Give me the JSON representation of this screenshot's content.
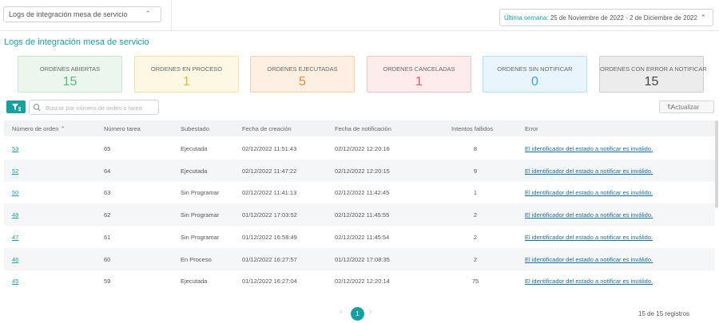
{
  "header": {
    "module_select": "Logs de integración mesa de servicio",
    "week_label": "Última semana:",
    "week_range": "25 de Noviembre de 2022 - 2 de Diciembre de 2022"
  },
  "page_title": "Logs de integración mesa de servicio",
  "cards": [
    {
      "label": "ORDENES ABIERTAS",
      "value": "15",
      "bg": "#eaf6ee",
      "border": "#c8e6d1",
      "value_color": "#5cb87a"
    },
    {
      "label": "ORDENES EN PROCESO",
      "value": "1",
      "bg": "#fdf8e4",
      "border": "#f2e3a8",
      "value_color": "#e5b53b"
    },
    {
      "label": "ORDENES EJECUTADAS",
      "value": "5",
      "bg": "#fdf0e3",
      "border": "#f2d2b0",
      "value_color": "#e98a35"
    },
    {
      "label": "ORDENES CANCELADAS",
      "value": "1",
      "bg": "#fdeceb",
      "border": "#f2c4c1",
      "value_color": "#e55b57"
    },
    {
      "label": "ORDENES SIN NOTIFICAR",
      "value": "0",
      "bg": "#e8f5fc",
      "border": "#b9e0f2",
      "value_color": "#3aa5d9"
    },
    {
      "label": "ORDENES CON ERROR A NOTIFICAR",
      "value": "15",
      "bg": "#ececec",
      "border": "#cfcfcf",
      "value_color": "#444444"
    }
  ],
  "toolbar": {
    "filter_icon": "filter-icon",
    "search_placeholder": "Buscar por número de orden o tarea",
    "refresh_label": "Actualizar"
  },
  "table": {
    "columns": [
      "Número de orden",
      "Número tarea",
      "Subestado",
      "Fecha de creación",
      "Fecha de notificación",
      "Intentos fallidos",
      "Error"
    ],
    "rows": [
      {
        "orden": "53",
        "tarea": "65",
        "subestado": "Ejecutada",
        "creacion": "02/12/2022 11:51:43",
        "notificacion": "02/12/2022 12:20:16",
        "intentos": "8",
        "error": "El identificador del estado a notificar es inválido."
      },
      {
        "orden": "52",
        "tarea": "64",
        "subestado": "Ejecutada",
        "creacion": "02/12/2022 11:47:22",
        "notificacion": "02/12/2022 12:20:15",
        "intentos": "9",
        "error": "El identificador del estado a notificar es inválido."
      },
      {
        "orden": "50",
        "tarea": "63",
        "subestado": "Sin Programar",
        "creacion": "02/12/2022 11:41:13",
        "notificacion": "02/12/2022 11:42:45",
        "intentos": "1",
        "error": "El identificador del estado a notificar es inválido."
      },
      {
        "orden": "48",
        "tarea": "62",
        "subestado": "Sin Programar",
        "creacion": "01/12/2022 17:03:52",
        "notificacion": "02/12/2022 11:45:55",
        "intentos": "2",
        "error": "El identificador del estado a notificar es inválido."
      },
      {
        "orden": "47",
        "tarea": "61",
        "subestado": "Sin Programar",
        "creacion": "01/12/2022 16:58:49",
        "notificacion": "02/12/2022 11:45:54",
        "intentos": "2",
        "error": "El identificador del estado a notificar es inválido."
      },
      {
        "orden": "46",
        "tarea": "60",
        "subestado": "En Proceso",
        "creacion": "01/12/2022 16:27:57",
        "notificacion": "01/12/2022 17:08:35",
        "intentos": "2",
        "error": "El identificador del estado a notificar es inválido."
      },
      {
        "orden": "45",
        "tarea": "59",
        "subestado": "Ejecutada",
        "creacion": "01/12/2022 16:27:04",
        "notificacion": "02/12/2022 12:20:14",
        "intentos": "75",
        "error": "El identificador del estado a notificar es inválido."
      }
    ]
  },
  "pagination": {
    "current_page": "1",
    "records": "15 de 15 registros"
  }
}
